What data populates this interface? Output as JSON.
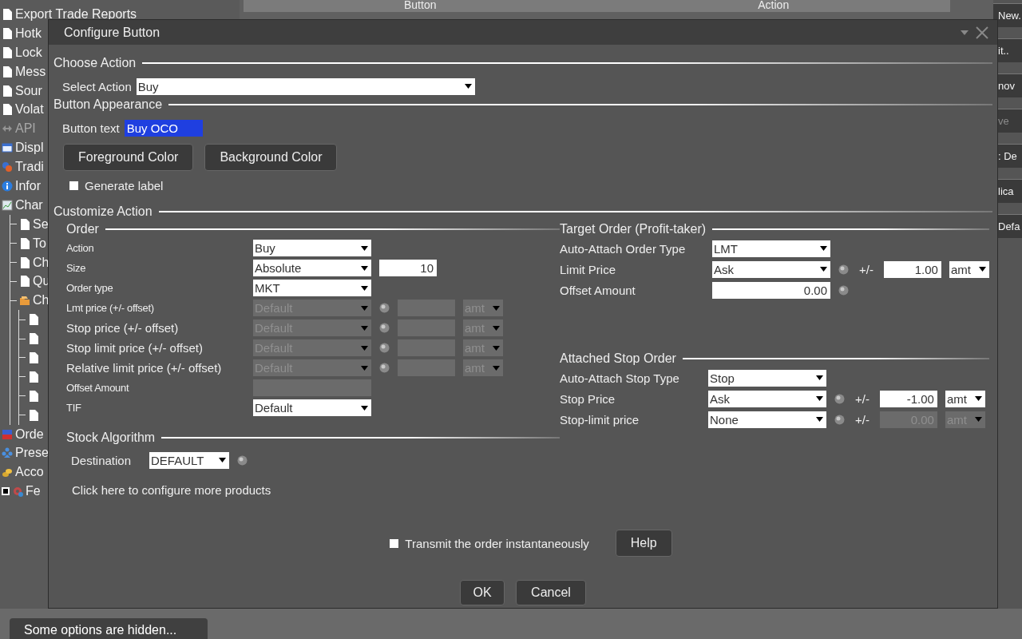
{
  "sidebar": {
    "items": [
      {
        "label": "Export Trade Reports",
        "kind": "page",
        "disabled": false
      },
      {
        "label": "Hotk",
        "kind": "page",
        "disabled": false
      },
      {
        "label": "Lock",
        "kind": "page",
        "disabled": false
      },
      {
        "label": "Mess",
        "kind": "page",
        "disabled": false
      },
      {
        "label": "Sour",
        "kind": "page",
        "disabled": false
      },
      {
        "label": "Volat",
        "kind": "page",
        "disabled": false
      },
      {
        "label": "API",
        "kind": "api",
        "disabled": true
      },
      {
        "label": "Displ",
        "kind": "display",
        "disabled": false
      },
      {
        "label": "Tradi",
        "kind": "trading",
        "disabled": false
      },
      {
        "label": "Infor",
        "kind": "info",
        "disabled": false
      },
      {
        "label": "Char",
        "kind": "chart",
        "disabled": false,
        "children": [
          {
            "label": "Se",
            "kind": "page",
            "disabled": false
          },
          {
            "label": "To",
            "kind": "page",
            "disabled": false
          },
          {
            "label": "Ch",
            "kind": "page",
            "disabled": false
          },
          {
            "label": "Qu",
            "kind": "page",
            "disabled": false
          },
          {
            "label": "Ch",
            "kind": "folder",
            "disabled": false,
            "children": [
              {
                "kind": "page",
                "disabled": false
              },
              {
                "kind": "page",
                "disabled": false
              },
              {
                "kind": "page",
                "disabled": false
              },
              {
                "kind": "page",
                "disabled": false
              },
              {
                "kind": "page",
                "disabled": false
              },
              {
                "kind": "page",
                "disabled": false
              }
            ]
          }
        ]
      },
      {
        "label": "Orde",
        "kind": "orders",
        "disabled": false
      },
      {
        "label": "Prese",
        "kind": "presets",
        "disabled": false
      },
      {
        "label": "Acco",
        "kind": "accounts",
        "disabled": false
      },
      {
        "label": "Fe",
        "kind": "feature",
        "disabled": false,
        "checked": false
      }
    ]
  },
  "table": {
    "columns": [
      "Button",
      "Action"
    ]
  },
  "side_buttons": [
    {
      "label": "New.",
      "disabled": false
    },
    {
      "label": "it..",
      "disabled": false
    },
    {
      "label": "nov",
      "disabled": false
    },
    {
      "label": "ve",
      "disabled": true
    },
    {
      "label": ": De",
      "disabled": false
    },
    {
      "label": "lica",
      "disabled": false
    },
    {
      "label": "Defa",
      "disabled": false
    }
  ],
  "hint_button": "Some options are hidden...",
  "dialog": {
    "title": "Configure Button",
    "choose_action": {
      "heading": "Choose Action",
      "label": "Select Action",
      "value": "Buy"
    },
    "appearance": {
      "heading": "Button Appearance",
      "text_label": "Button text",
      "text_value": "Buy OCO",
      "text_selected": true,
      "buttons": [
        "Foreground Color",
        "Background Color"
      ],
      "generate_label": {
        "label": "Generate label",
        "checked": false
      }
    },
    "customize": {
      "heading": "Customize Action",
      "order": {
        "heading": "Order",
        "rows": [
          {
            "label": "Action",
            "compact": true,
            "controls": [
              {
                "kind": "select",
                "value": "Buy",
                "disabled": false
              }
            ]
          },
          {
            "label": "Size",
            "compact": true,
            "controls": [
              {
                "kind": "select",
                "value": "Absolute",
                "disabled": false
              },
              {
                "kind": "number",
                "value": "10",
                "disabled": false
              }
            ]
          },
          {
            "label": "Order type",
            "compact": true,
            "controls": [
              {
                "kind": "select",
                "value": "MKT",
                "disabled": false
              }
            ]
          },
          {
            "label": "Lmt price (+/- offset)",
            "compact": true,
            "controls": [
              {
                "kind": "select",
                "value": "Default",
                "disabled": true
              },
              {
                "kind": "info"
              },
              {
                "kind": "number",
                "disabled": true
              },
              {
                "kind": "unit",
                "value": "amt",
                "disabled": true
              }
            ]
          },
          {
            "label": "Stop price (+/- offset)",
            "compact": false,
            "controls": [
              {
                "kind": "select",
                "value": "Default",
                "disabled": true
              },
              {
                "kind": "info"
              },
              {
                "kind": "number",
                "disabled": true
              },
              {
                "kind": "unit",
                "value": "amt",
                "disabled": true
              }
            ]
          },
          {
            "label": "Stop limit price (+/- offset)",
            "compact": false,
            "controls": [
              {
                "kind": "select",
                "value": "Default",
                "disabled": true
              },
              {
                "kind": "info"
              },
              {
                "kind": "number",
                "disabled": true
              },
              {
                "kind": "unit",
                "value": "amt",
                "disabled": true
              }
            ]
          },
          {
            "label": "Relative limit price (+/- offset)",
            "compact": false,
            "controls": [
              {
                "kind": "select",
                "value": "Default",
                "disabled": true
              },
              {
                "kind": "info"
              },
              {
                "kind": "number",
                "disabled": true
              },
              {
                "kind": "unit",
                "value": "amt",
                "disabled": true
              }
            ]
          },
          {
            "label": "Offset Amount",
            "compact": true,
            "controls": [
              {
                "kind": "field",
                "disabled": true
              }
            ]
          },
          {
            "label": "TIF",
            "compact": true,
            "controls": [
              {
                "kind": "select",
                "value": "Default",
                "disabled": false
              }
            ]
          }
        ]
      },
      "algorithm": {
        "heading": "Stock Algorithm",
        "rows": [
          {
            "label": "Destination",
            "compact": false,
            "controls": [
              {
                "kind": "short_select",
                "value": "DEFAULT",
                "disabled": false
              },
              {
                "kind": "info"
              }
            ]
          }
        ]
      },
      "link": "Click here to configure more products",
      "target": {
        "heading": "Target Order (Profit-taker)",
        "rows": [
          {
            "label": "Auto-Attach Order Type",
            "compact": false,
            "controls": [
              {
                "kind": "select",
                "value": "LMT",
                "disabled": false
              }
            ]
          },
          {
            "label": "Limit Price",
            "compact": false,
            "controls": [
              {
                "kind": "select",
                "value": "Ask",
                "disabled": false
              },
              {
                "kind": "info"
              },
              {
                "kind": "sign",
                "text": "+/-"
              },
              {
                "kind": "number",
                "value": "1.00",
                "disabled": false
              },
              {
                "kind": "unit",
                "value": "amt",
                "disabled": false
              }
            ]
          },
          {
            "label": "Offset Amount",
            "compact": false,
            "controls": [
              {
                "kind": "field",
                "value": "0.00",
                "disabled": false
              },
              {
                "kind": "info"
              }
            ]
          }
        ]
      },
      "stop": {
        "heading": "Attached Stop Order",
        "rows": [
          {
            "label": "Auto-Attach Stop Type",
            "compact": false,
            "controls": [
              {
                "kind": "select",
                "value": "Stop",
                "disabled": false
              }
            ]
          },
          {
            "label": "Stop Price",
            "compact": false,
            "controls": [
              {
                "kind": "select",
                "value": "Ask",
                "disabled": false
              },
              {
                "kind": "info"
              },
              {
                "kind": "sign",
                "text": "+/-"
              },
              {
                "kind": "number",
                "value": "-1.00",
                "disabled": false
              },
              {
                "kind": "unit",
                "value": "amt",
                "disabled": false
              }
            ]
          },
          {
            "label": "Stop-limit price",
            "compact": false,
            "controls": [
              {
                "kind": "select",
                "value": "None",
                "disabled": false
              },
              {
                "kind": "info"
              },
              {
                "kind": "sign",
                "text": "+/-"
              },
              {
                "kind": "number",
                "value": "0.00",
                "disabled": true
              },
              {
                "kind": "unit",
                "value": "amt",
                "disabled": true
              }
            ]
          }
        ]
      }
    },
    "footer": {
      "transmit": {
        "label": "Transmit the order instantaneously",
        "checked": false
      },
      "help": "Help",
      "buttons": [
        "OK",
        "Cancel"
      ]
    }
  }
}
